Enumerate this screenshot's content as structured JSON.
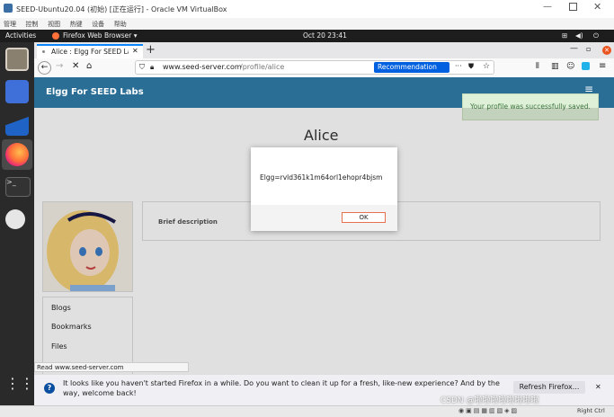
{
  "vbox": {
    "title": "SEED-Ubuntu20.04 (初始) [正在运行] - Oracle VM VirtualBox",
    "menu": [
      "管理",
      "控制",
      "视图",
      "热键",
      "设备",
      "帮助"
    ],
    "status_right": "Right Ctrl"
  },
  "topbar": {
    "activities": "Activities",
    "app": "Firefox Web Browser ▾",
    "clock": "Oct 20  23:41"
  },
  "browser": {
    "tab_title": "Alice : Elgg For SEED Lab",
    "url_domain": "www.seed-server.com",
    "url_path": "/profile/alice",
    "recommendation": "Recommendation",
    "status_url": "Read www.seed-server.com"
  },
  "site": {
    "name": "Elgg For SEED Labs",
    "profile_name": "Alice",
    "success_msg": "Your profile was successfully saved.",
    "brief_label": "Brief description",
    "menu": [
      "Blogs",
      "Bookmarks",
      "Files"
    ]
  },
  "alert": {
    "message": "Elgg=rvld361k1m64orl1ehopr4bjsm",
    "ok": "OK"
  },
  "notification": {
    "text": "It looks like you haven't started Firefox in a while. Do you want to clean it up for a fresh, like-new experience? And by the way, welcome back!",
    "button": "Refresh Firefox...",
    "close": "✕"
  },
  "watermark": "CSDN @啦啦啦啦啦啦啦啦"
}
